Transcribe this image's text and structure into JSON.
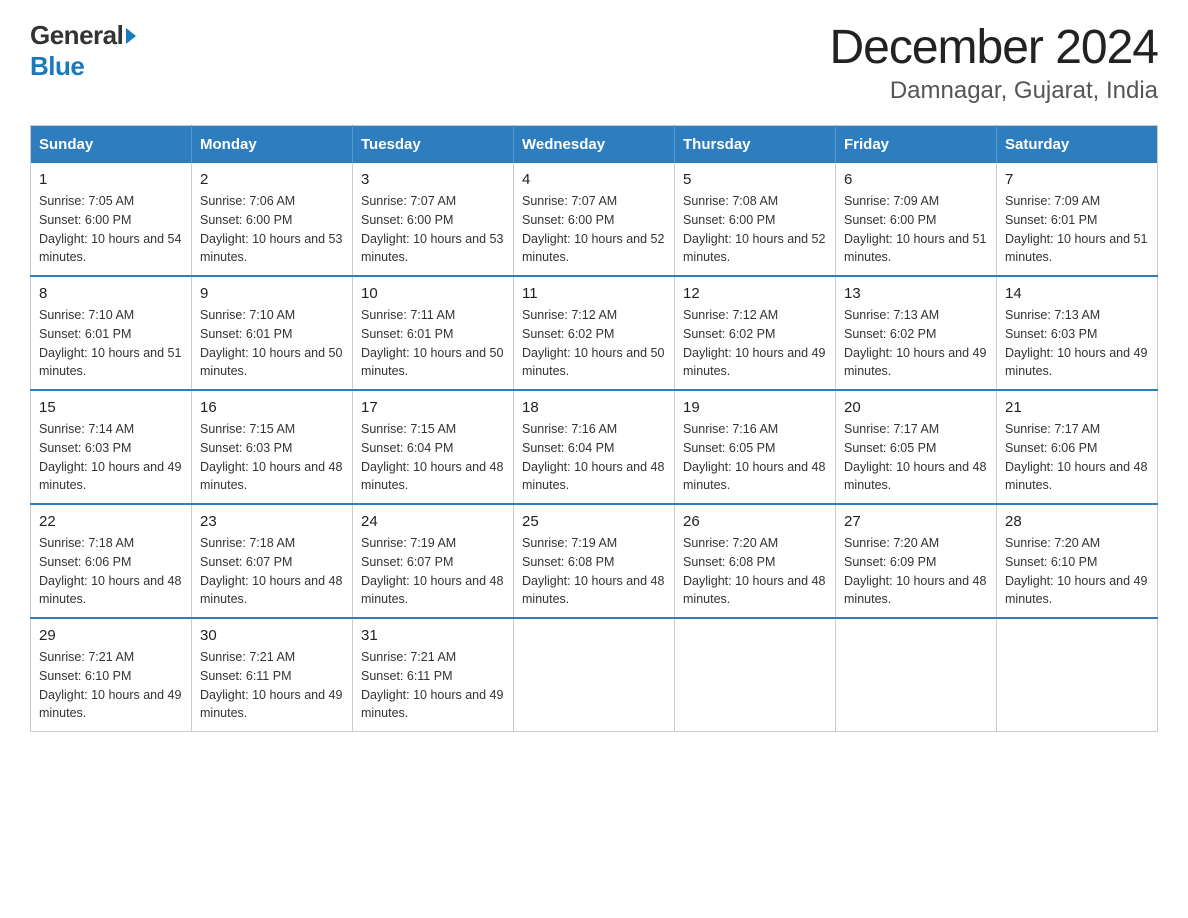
{
  "logo": {
    "general": "General",
    "blue": "Blue"
  },
  "title": "December 2024",
  "subtitle": "Damnagar, Gujarat, India",
  "days_of_week": [
    "Sunday",
    "Monday",
    "Tuesday",
    "Wednesday",
    "Thursday",
    "Friday",
    "Saturday"
  ],
  "weeks": [
    [
      {
        "day": "1",
        "sunrise": "7:05 AM",
        "sunset": "6:00 PM",
        "daylight": "10 hours and 54 minutes."
      },
      {
        "day": "2",
        "sunrise": "7:06 AM",
        "sunset": "6:00 PM",
        "daylight": "10 hours and 53 minutes."
      },
      {
        "day": "3",
        "sunrise": "7:07 AM",
        "sunset": "6:00 PM",
        "daylight": "10 hours and 53 minutes."
      },
      {
        "day": "4",
        "sunrise": "7:07 AM",
        "sunset": "6:00 PM",
        "daylight": "10 hours and 52 minutes."
      },
      {
        "day": "5",
        "sunrise": "7:08 AM",
        "sunset": "6:00 PM",
        "daylight": "10 hours and 52 minutes."
      },
      {
        "day": "6",
        "sunrise": "7:09 AM",
        "sunset": "6:00 PM",
        "daylight": "10 hours and 51 minutes."
      },
      {
        "day": "7",
        "sunrise": "7:09 AM",
        "sunset": "6:01 PM",
        "daylight": "10 hours and 51 minutes."
      }
    ],
    [
      {
        "day": "8",
        "sunrise": "7:10 AM",
        "sunset": "6:01 PM",
        "daylight": "10 hours and 51 minutes."
      },
      {
        "day": "9",
        "sunrise": "7:10 AM",
        "sunset": "6:01 PM",
        "daylight": "10 hours and 50 minutes."
      },
      {
        "day": "10",
        "sunrise": "7:11 AM",
        "sunset": "6:01 PM",
        "daylight": "10 hours and 50 minutes."
      },
      {
        "day": "11",
        "sunrise": "7:12 AM",
        "sunset": "6:02 PM",
        "daylight": "10 hours and 50 minutes."
      },
      {
        "day": "12",
        "sunrise": "7:12 AM",
        "sunset": "6:02 PM",
        "daylight": "10 hours and 49 minutes."
      },
      {
        "day": "13",
        "sunrise": "7:13 AM",
        "sunset": "6:02 PM",
        "daylight": "10 hours and 49 minutes."
      },
      {
        "day": "14",
        "sunrise": "7:13 AM",
        "sunset": "6:03 PM",
        "daylight": "10 hours and 49 minutes."
      }
    ],
    [
      {
        "day": "15",
        "sunrise": "7:14 AM",
        "sunset": "6:03 PM",
        "daylight": "10 hours and 49 minutes."
      },
      {
        "day": "16",
        "sunrise": "7:15 AM",
        "sunset": "6:03 PM",
        "daylight": "10 hours and 48 minutes."
      },
      {
        "day": "17",
        "sunrise": "7:15 AM",
        "sunset": "6:04 PM",
        "daylight": "10 hours and 48 minutes."
      },
      {
        "day": "18",
        "sunrise": "7:16 AM",
        "sunset": "6:04 PM",
        "daylight": "10 hours and 48 minutes."
      },
      {
        "day": "19",
        "sunrise": "7:16 AM",
        "sunset": "6:05 PM",
        "daylight": "10 hours and 48 minutes."
      },
      {
        "day": "20",
        "sunrise": "7:17 AM",
        "sunset": "6:05 PM",
        "daylight": "10 hours and 48 minutes."
      },
      {
        "day": "21",
        "sunrise": "7:17 AM",
        "sunset": "6:06 PM",
        "daylight": "10 hours and 48 minutes."
      }
    ],
    [
      {
        "day": "22",
        "sunrise": "7:18 AM",
        "sunset": "6:06 PM",
        "daylight": "10 hours and 48 minutes."
      },
      {
        "day": "23",
        "sunrise": "7:18 AM",
        "sunset": "6:07 PM",
        "daylight": "10 hours and 48 minutes."
      },
      {
        "day": "24",
        "sunrise": "7:19 AM",
        "sunset": "6:07 PM",
        "daylight": "10 hours and 48 minutes."
      },
      {
        "day": "25",
        "sunrise": "7:19 AM",
        "sunset": "6:08 PM",
        "daylight": "10 hours and 48 minutes."
      },
      {
        "day": "26",
        "sunrise": "7:20 AM",
        "sunset": "6:08 PM",
        "daylight": "10 hours and 48 minutes."
      },
      {
        "day": "27",
        "sunrise": "7:20 AM",
        "sunset": "6:09 PM",
        "daylight": "10 hours and 48 minutes."
      },
      {
        "day": "28",
        "sunrise": "7:20 AM",
        "sunset": "6:10 PM",
        "daylight": "10 hours and 49 minutes."
      }
    ],
    [
      {
        "day": "29",
        "sunrise": "7:21 AM",
        "sunset": "6:10 PM",
        "daylight": "10 hours and 49 minutes."
      },
      {
        "day": "30",
        "sunrise": "7:21 AM",
        "sunset": "6:11 PM",
        "daylight": "10 hours and 49 minutes."
      },
      {
        "day": "31",
        "sunrise": "7:21 AM",
        "sunset": "6:11 PM",
        "daylight": "10 hours and 49 minutes."
      },
      null,
      null,
      null,
      null
    ]
  ]
}
